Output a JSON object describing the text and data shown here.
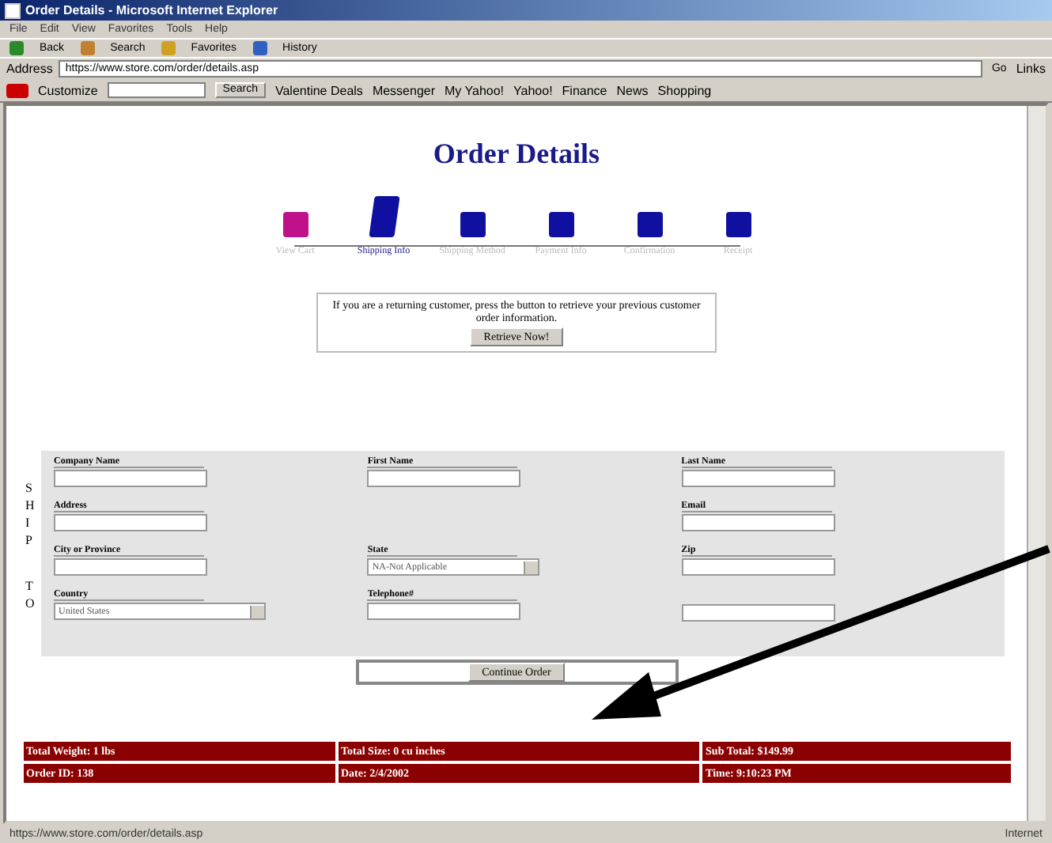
{
  "window": {
    "title": "Order Details - Microsoft Internet Explorer"
  },
  "menu": [
    "File",
    "Edit",
    "View",
    "Favorites",
    "Tools",
    "Help"
  ],
  "toolbar": [
    "Back",
    "Search",
    "Favorites",
    "History"
  ],
  "address": {
    "label": "Address",
    "url": "https://www.store.com/order/details.asp",
    "go": "Go",
    "links": "Links"
  },
  "yahoo_bar": {
    "customize": "Customize",
    "search_button": "Search",
    "links": [
      "Valentine Deals",
      "Messenger",
      "My Yahoo!",
      "Yahoo!",
      "Finance",
      "News",
      "Shopping"
    ]
  },
  "page": {
    "heading": "Order Details",
    "steps": [
      {
        "label": "View Cart",
        "selected": false,
        "completed": true
      },
      {
        "label": "Shipping Info",
        "selected": true,
        "completed": false
      },
      {
        "label": "Shipping Method",
        "selected": false,
        "completed": false
      },
      {
        "label": "Payment Info",
        "selected": false,
        "completed": false
      },
      {
        "label": "Confirmation",
        "selected": false,
        "completed": false
      },
      {
        "label": "Receipt",
        "selected": false,
        "completed": false
      }
    ],
    "returning_note": "If you are a returning customer, press the button to retrieve your previous customer order information.",
    "retrieve_button": "Retrieve Now!",
    "side_label": [
      "S",
      "H",
      "I",
      "P",
      "T",
      "O"
    ],
    "fields": [
      {
        "label": "Company Name",
        "kind": "text"
      },
      {
        "label": "First Name",
        "kind": "text"
      },
      {
        "label": "Last Name",
        "kind": "text"
      },
      {
        "label": "Address",
        "kind": "text"
      },
      {
        "kind": "empty"
      },
      {
        "label": "Email",
        "kind": "text"
      },
      {
        "label": "City or Province",
        "kind": "text"
      },
      {
        "label": "State",
        "kind": "select",
        "value": "NA-Not Applicable"
      },
      {
        "label": "Zip",
        "kind": "text"
      },
      {
        "label": "Country",
        "kind": "select",
        "value": "United States"
      },
      {
        "label": "Telephone#",
        "kind": "text"
      },
      {
        "kind": "text"
      }
    ],
    "continue_button": "Continue Order",
    "summary": [
      [
        "Total Weight: 1 lbs",
        "Total Size: 0 cu inches",
        "Sub Total: $149.99"
      ],
      [
        "Order ID: 138",
        "Date: 2/4/2002",
        "Time: 9:10:23 PM"
      ]
    ]
  },
  "status_bar": {
    "text": "https://www.store.com/order/details.asp",
    "zone": "Internet"
  }
}
